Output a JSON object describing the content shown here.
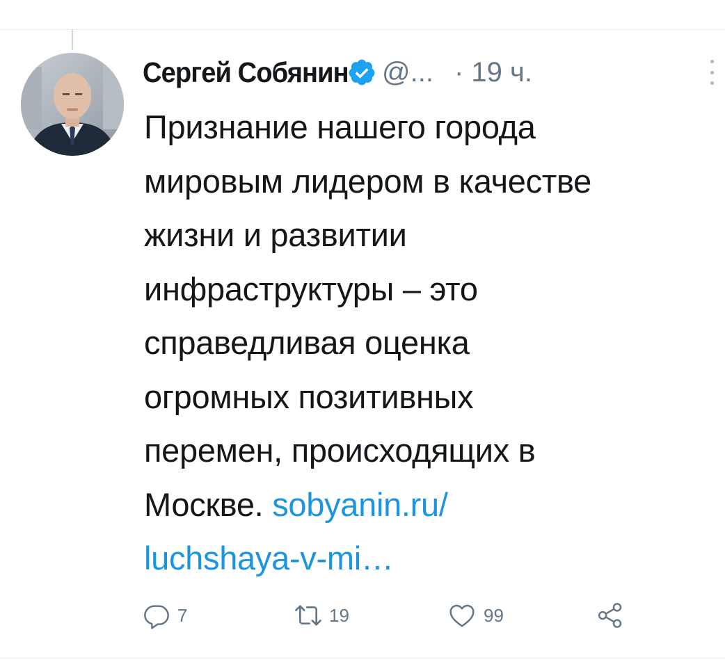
{
  "tweet": {
    "author": {
      "display_name": "Сергей Собянин",
      "handle": "@...",
      "verified": true
    },
    "time": "· 19 ч.",
    "text_lines": [
      "Признание нашего города",
      "мировым лидером в качестве",
      "жизни и развитии",
      "инфраструктуры – это",
      "справедливая оценка",
      "огромных позитивных",
      "перемен, происходящих в"
    ],
    "last_line_text": "Москве. ",
    "link_part1": "sobyanin.ru/",
    "link_part2": "luchshaya-v-mi…",
    "actions": {
      "reply_count": "7",
      "retweet_count": "19",
      "like_count": "99"
    }
  },
  "icons": {
    "verified": "verified-badge-icon",
    "more": "more-options-icon",
    "reply": "reply-icon",
    "retweet": "retweet-icon",
    "like": "like-icon",
    "share": "share-icon"
  },
  "colors": {
    "text": "#14171a",
    "secondary": "#657786",
    "link": "#1b95e0",
    "verified": "#1da1f2"
  }
}
